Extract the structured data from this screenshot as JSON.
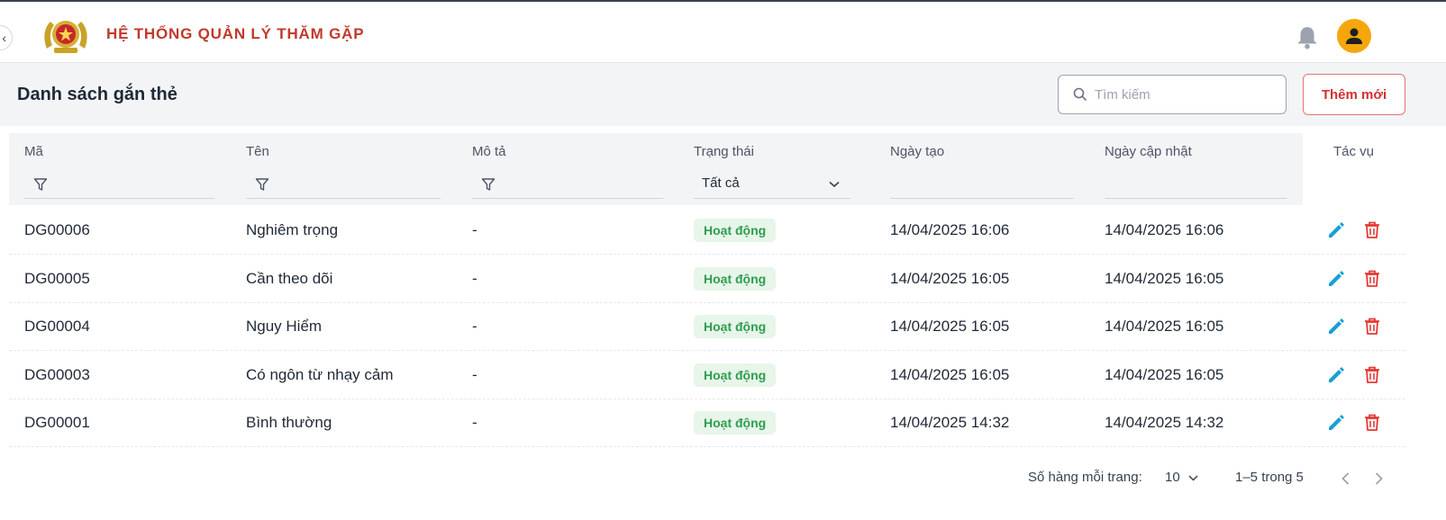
{
  "app": {
    "title": "HỆ THỐNG QUẢN LÝ THĂM GẶP",
    "collapse_glyph": "‹",
    "brand_color": "#c0392b",
    "avatar_color": "#f5a60a"
  },
  "page": {
    "title": "Danh sách gắn thẻ",
    "search_placeholder": "Tìm kiếm",
    "search_value": "",
    "add_label": "Thêm mới"
  },
  "table": {
    "columns": {
      "code": "Mã",
      "name": "Tên",
      "description": "Mô tả",
      "status": "Trạng thái",
      "created": "Ngày tạo",
      "updated": "Ngày cập nhật",
      "actions": "Tác vụ"
    },
    "status_filter": "Tất cả",
    "rows": [
      {
        "code": "DG00006",
        "name": "Nghiêm trọng",
        "description": "-",
        "status": "Hoạt động",
        "created": "14/04/2025 16:06",
        "updated": "14/04/2025 16:06"
      },
      {
        "code": "DG00005",
        "name": "Cần theo dõi",
        "description": "-",
        "status": "Hoạt động",
        "created": "14/04/2025 16:05",
        "updated": "14/04/2025 16:05"
      },
      {
        "code": "DG00004",
        "name": "Nguy Hiểm",
        "description": "-",
        "status": "Hoạt động",
        "created": "14/04/2025 16:05",
        "updated": "14/04/2025 16:05"
      },
      {
        "code": "DG00003",
        "name": "Có ngôn từ nhạy cảm",
        "description": "-",
        "status": "Hoạt động",
        "created": "14/04/2025 16:05",
        "updated": "14/04/2025 16:05"
      },
      {
        "code": "DG00001",
        "name": "Bình thường",
        "description": "-",
        "status": "Hoạt động",
        "created": "14/04/2025 14:32",
        "updated": "14/04/2025 14:32"
      }
    ],
    "icons": {
      "edit": "pencil-icon",
      "delete": "trash-icon",
      "filter": "filter-icon"
    },
    "edit_color": "#1a9fd4",
    "delete_color": "#e53935",
    "status_color": "#2e9d4f"
  },
  "pagination": {
    "rows_per_page_label": "Số hàng mỗi trang:",
    "rows_per_page": "10",
    "range": "1–5 trong 5"
  }
}
